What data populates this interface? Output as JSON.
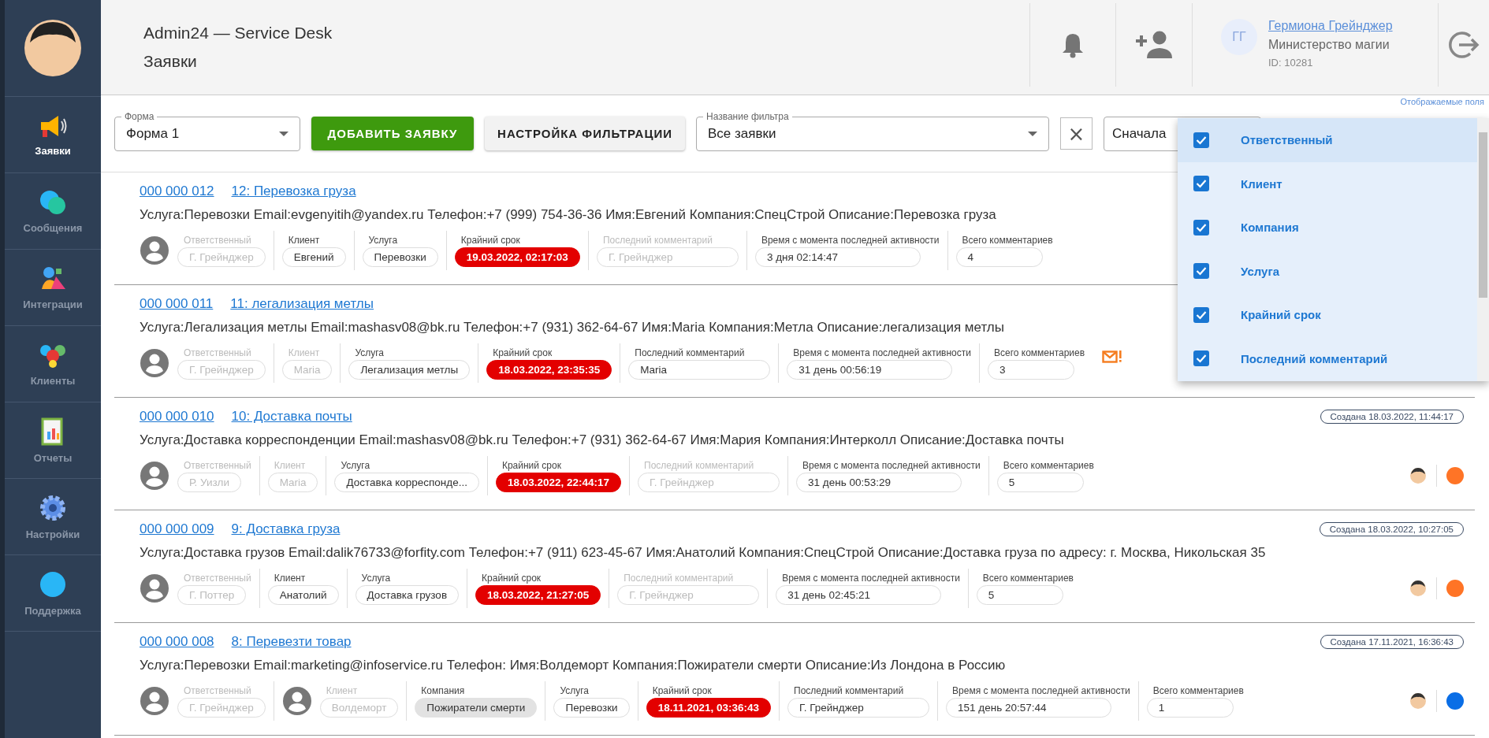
{
  "sidebar": {
    "items": [
      {
        "label": "Заявки",
        "selected": true
      },
      {
        "label": "Сообщения",
        "selected": false
      },
      {
        "label": "Интеграции",
        "selected": false
      },
      {
        "label": "Клиенты",
        "selected": false
      },
      {
        "label": "Отчеты",
        "selected": false
      },
      {
        "label": "Настройки",
        "selected": false
      },
      {
        "label": "Поддержка",
        "selected": false
      }
    ]
  },
  "header": {
    "title": "Admin24 — Service Desk",
    "subtitle": "Заявки",
    "user": {
      "initials": "ГГ",
      "name": "Гермиона Грейнджер",
      "org": "Министерство магии",
      "id": "ID: 10281"
    }
  },
  "filters": {
    "form": {
      "label": "Форма",
      "value": "Форма 1"
    },
    "add_button": "ДОБАВИТЬ ЗАЯВКУ",
    "settings_button": "НАСТРОЙКА ФИЛЬТРАЦИИ",
    "filter_name": {
      "label": "Название фильтра",
      "value": "Все заявки"
    },
    "clear": "×",
    "sort": {
      "value": "Сначала"
    },
    "fields_link": "Отображаемые поля"
  },
  "fields_menu": [
    {
      "label": "Ответственный",
      "checked": true,
      "selected": true
    },
    {
      "label": "Клиент",
      "checked": true,
      "selected": false
    },
    {
      "label": "Компания",
      "checked": true,
      "selected": false
    },
    {
      "label": "Услуга",
      "checked": true,
      "selected": false
    },
    {
      "label": "Крайний срок",
      "checked": true,
      "selected": false
    },
    {
      "label": "Последний комментарий",
      "checked": true,
      "selected": false
    }
  ],
  "tickets": [
    {
      "number": "000 000 012",
      "title": "12: Перевозка груза",
      "description": "Услуга:Перевозки Email:evgenyitih@yandex.ru Телефон:+7 (999) 754-36-36 Имя:Евгений Компания:СпецСтрой Описание:Перевозка груза",
      "unread": false,
      "fields": [
        {
          "label": "Ответственный",
          "value": "Г. Грейнджер",
          "kind": "text",
          "avatar": true,
          "blurred": true
        },
        {
          "label": "Клиент",
          "value": "Евгений",
          "kind": "text",
          "avatar": false,
          "blurred": false
        },
        {
          "label": "Услуга",
          "value": "Перевозки",
          "kind": "text",
          "avatar": false,
          "blurred": false
        },
        {
          "label": "Крайний срок",
          "value": "19.03.2022, 02:17:03",
          "kind": "deadline",
          "avatar": false,
          "blurred": false
        },
        {
          "label": "Последний комментарий",
          "value": "Г. Грейнджер",
          "kind": "wide",
          "avatar": false,
          "blurred": true
        },
        {
          "label": "Время с момента последней активности",
          "value": "3 дня 02:14:47",
          "kind": "time",
          "avatar": false,
          "blurred": false
        },
        {
          "label": "Всего комментариев",
          "value": "4",
          "kind": "count",
          "avatar": false,
          "blurred": false
        }
      ]
    },
    {
      "number": "000 000 011",
      "title": "11: легализация метлы",
      "description": "Услуга:Легализация метлы Email:mashasv08@bk.ru Телефон:+7 (931) 362-64-67 Имя:Maria Компания:Метла Описание:легализация метлы",
      "unread": true,
      "fields": [
        {
          "label": "Ответственный",
          "value": "Г. Грейнджер",
          "kind": "text",
          "avatar": true,
          "blurred": true
        },
        {
          "label": "Клиент",
          "value": "Maria",
          "kind": "text",
          "avatar": false,
          "blurred": true
        },
        {
          "label": "Услуга",
          "value": "Легализация метлы",
          "kind": "text",
          "avatar": false,
          "blurred": false
        },
        {
          "label": "Крайний срок",
          "value": "18.03.2022, 23:35:35",
          "kind": "deadline",
          "avatar": false,
          "blurred": false
        },
        {
          "label": "Последний комментарий",
          "value": "Maria",
          "kind": "wide",
          "avatar": false,
          "blurred": false
        },
        {
          "label": "Время с момента последней активности",
          "value": "31 день 00:56:19",
          "kind": "time",
          "avatar": false,
          "blurred": false
        },
        {
          "label": "Всего комментариев",
          "value": "3",
          "kind": "count",
          "avatar": false,
          "blurred": false
        }
      ]
    },
    {
      "number": "000 000 010",
      "title": "10: Доставка почты",
      "created": "Создана 18.03.2022, 11:44:17",
      "color": "#ff7426",
      "description": "Услуга:Доставка корреспонденции Email:mashasv08@bk.ru Телефон:+7 (931) 362-64-67 Имя:Мария Компания:Интерколл Описание:Доставка почты",
      "unread": false,
      "fields": [
        {
          "label": "Ответственный",
          "value": "Р. Уизли",
          "kind": "text",
          "avatar": true,
          "blurred": true
        },
        {
          "label": "Клиент",
          "value": "Maria",
          "kind": "text",
          "avatar": false,
          "blurred": true
        },
        {
          "label": "Услуга",
          "value": "Доставка корреспонде...",
          "kind": "text",
          "avatar": false,
          "blurred": false
        },
        {
          "label": "Крайний срок",
          "value": "18.03.2022, 22:44:17",
          "kind": "deadline",
          "avatar": false,
          "blurred": false
        },
        {
          "label": "Последний комментарий",
          "value": "Г. Грейнджер",
          "kind": "wide",
          "avatar": false,
          "blurred": true
        },
        {
          "label": "Время с момента последней активности",
          "value": "31 день 00:53:29",
          "kind": "time",
          "avatar": false,
          "blurred": false
        },
        {
          "label": "Всего комментариев",
          "value": "5",
          "kind": "count",
          "avatar": false,
          "blurred": false
        }
      ]
    },
    {
      "number": "000 000 009",
      "title": "9: Доставка груза",
      "created": "Создана 18.03.2022, 10:27:05",
      "color": "#ff7426",
      "description": "Услуга:Доставка грузов Email:dalik76733@forfity.com Телефон:+7 (911) 623-45-67 Имя:Анатолий Компания:СпецСтрой Описание:Доставка груза по адресу: г. Москва, Никольская 35",
      "unread": false,
      "fields": [
        {
          "label": "Ответственный",
          "value": "Г. Поттер",
          "kind": "text",
          "avatar": true,
          "blurred": true
        },
        {
          "label": "Клиент",
          "value": "Анатолий",
          "kind": "text",
          "avatar": false,
          "blurred": false
        },
        {
          "label": "Услуга",
          "value": "Доставка грузов",
          "kind": "text",
          "avatar": false,
          "blurred": false
        },
        {
          "label": "Крайний срок",
          "value": "18.03.2022, 21:27:05",
          "kind": "deadline",
          "avatar": false,
          "blurred": false
        },
        {
          "label": "Последний комментарий",
          "value": "Г. Грейнджер",
          "kind": "wide",
          "avatar": false,
          "blurred": true
        },
        {
          "label": "Время с момента последней активности",
          "value": "31 день 02:45:21",
          "kind": "time",
          "avatar": false,
          "blurred": false
        },
        {
          "label": "Всего комментариев",
          "value": "5",
          "kind": "count",
          "avatar": false,
          "blurred": false
        }
      ]
    },
    {
      "number": "000 000 008",
      "title": "8: Перевезти товар",
      "created": "Создана 17.11.2021, 16:36:43",
      "color": "#0a6ee6",
      "description": "Услуга:Перевозки Email:marketing@infoservice.ru Телефон: Имя:Волдеморт Компания:Пожиратели смерти Описание:Из Лондона в Россию",
      "unread": false,
      "fields": [
        {
          "label": "Ответственный",
          "value": "Г. Грейнджер",
          "kind": "text",
          "avatar": true,
          "blurred": true
        },
        {
          "label": "Клиент",
          "value": "Волдеморт",
          "kind": "text",
          "avatar": true,
          "blurred": true
        },
        {
          "label": "Компания",
          "value": "Пожиратели смерти",
          "kind": "company",
          "avatar": false,
          "blurred": false
        },
        {
          "label": "Услуга",
          "value": "Перевозки",
          "kind": "text",
          "avatar": false,
          "blurred": false
        },
        {
          "label": "Крайний срок",
          "value": "18.11.2021, 03:36:43",
          "kind": "deadline",
          "avatar": false,
          "blurred": false
        },
        {
          "label": "Последний комментарий",
          "value": "Г. Грейнджер",
          "kind": "wide",
          "avatar": false,
          "blurred": false
        },
        {
          "label": "Время с момента последней активности",
          "value": "151 день 20:57:44",
          "kind": "time",
          "avatar": false,
          "blurred": false
        },
        {
          "label": "Всего комментариев",
          "value": "1",
          "kind": "count",
          "avatar": false,
          "blurred": false
        }
      ]
    }
  ]
}
